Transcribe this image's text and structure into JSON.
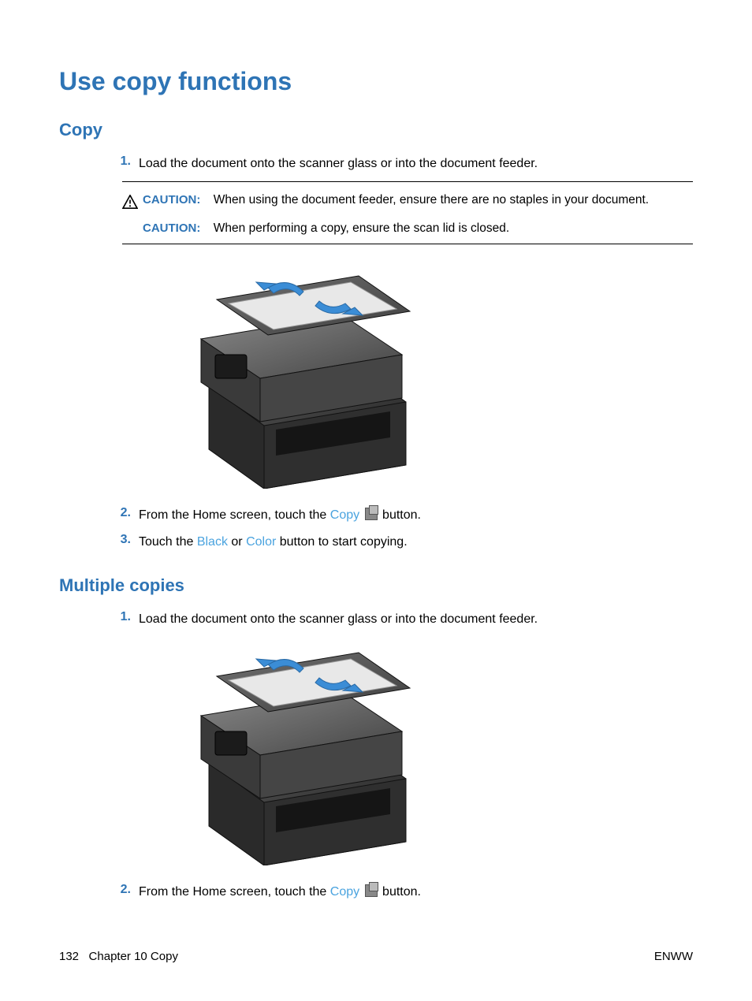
{
  "h1": "Use copy functions",
  "sectionCopy": {
    "title": "Copy",
    "steps": {
      "s1_num": "1.",
      "s1_text": "Load the document onto the scanner glass or into the document feeder.",
      "s2_num": "2.",
      "s2_a": "From the Home screen, touch the ",
      "s2_link": "Copy",
      "s2_b": " button.",
      "s3_num": "3.",
      "s3_a": "Touch the ",
      "s3_link1": "Black",
      "s3_mid": " or ",
      "s3_link2": "Color",
      "s3_b": " button to start copying."
    },
    "caution": {
      "label1": "CAUTION:",
      "text1": "When using the document feeder, ensure there are no staples in your document.",
      "label2": "CAUTION:",
      "text2": "When performing a copy, ensure the scan lid is closed."
    }
  },
  "sectionMultiple": {
    "title": "Multiple copies",
    "steps": {
      "s1_num": "1.",
      "s1_text": "Load the document onto the scanner glass or into the document feeder.",
      "s2_num": "2.",
      "s2_a": "From the Home screen, touch the ",
      "s2_link": "Copy",
      "s2_b": " button."
    }
  },
  "footer": {
    "page": "132",
    "chapter": "Chapter 10   Copy",
    "right": "ENWW"
  }
}
